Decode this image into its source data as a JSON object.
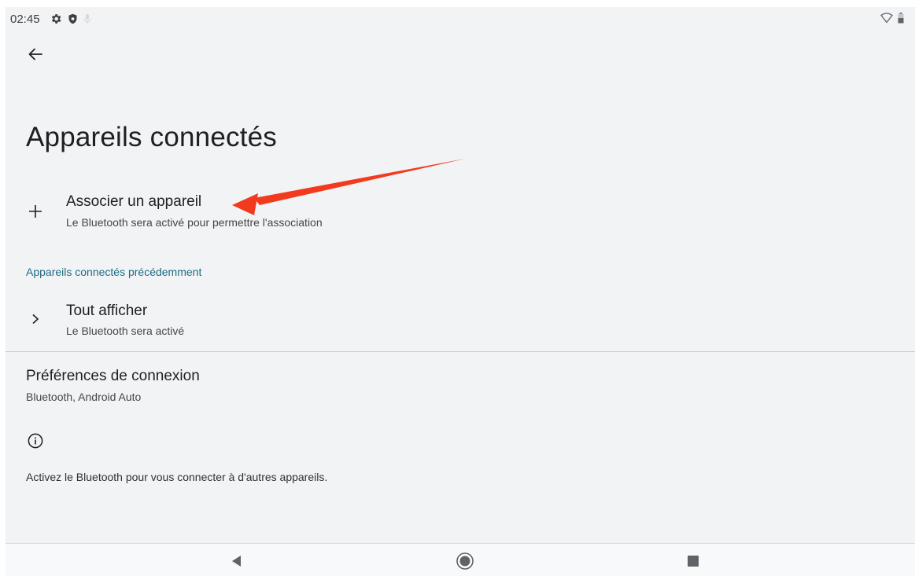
{
  "status_bar": {
    "time": "02:45",
    "left_icons": [
      "settings-icon",
      "shield-icon",
      "mic-off-icon"
    ],
    "right_icons": [
      "wifi-icon",
      "battery-icon"
    ]
  },
  "page": {
    "title": "Appareils connectés"
  },
  "pair_device": {
    "icon": "plus-icon",
    "title": "Associer un appareil",
    "subtitle": "Le Bluetooth sera activé pour permettre l'association"
  },
  "previous_section": {
    "header": "Appareils connectés précédemment",
    "see_all": {
      "icon": "chevron-right-icon",
      "title": "Tout afficher",
      "subtitle": "Le Bluetooth sera activé"
    }
  },
  "connection_prefs": {
    "title": "Préférences de connexion",
    "subtitle": "Bluetooth, Android Auto"
  },
  "info": {
    "icon": "info-icon",
    "text": "Activez le Bluetooth pour vous connecter à d'autres appareils."
  },
  "nav_bar": {
    "buttons": [
      "back-triangle-icon",
      "home-circle-icon",
      "recents-square-icon"
    ]
  },
  "annotation": {
    "color": "#f23a1e"
  },
  "colors": {
    "background": "#f1f3f5",
    "accent": "#1d6b84"
  }
}
